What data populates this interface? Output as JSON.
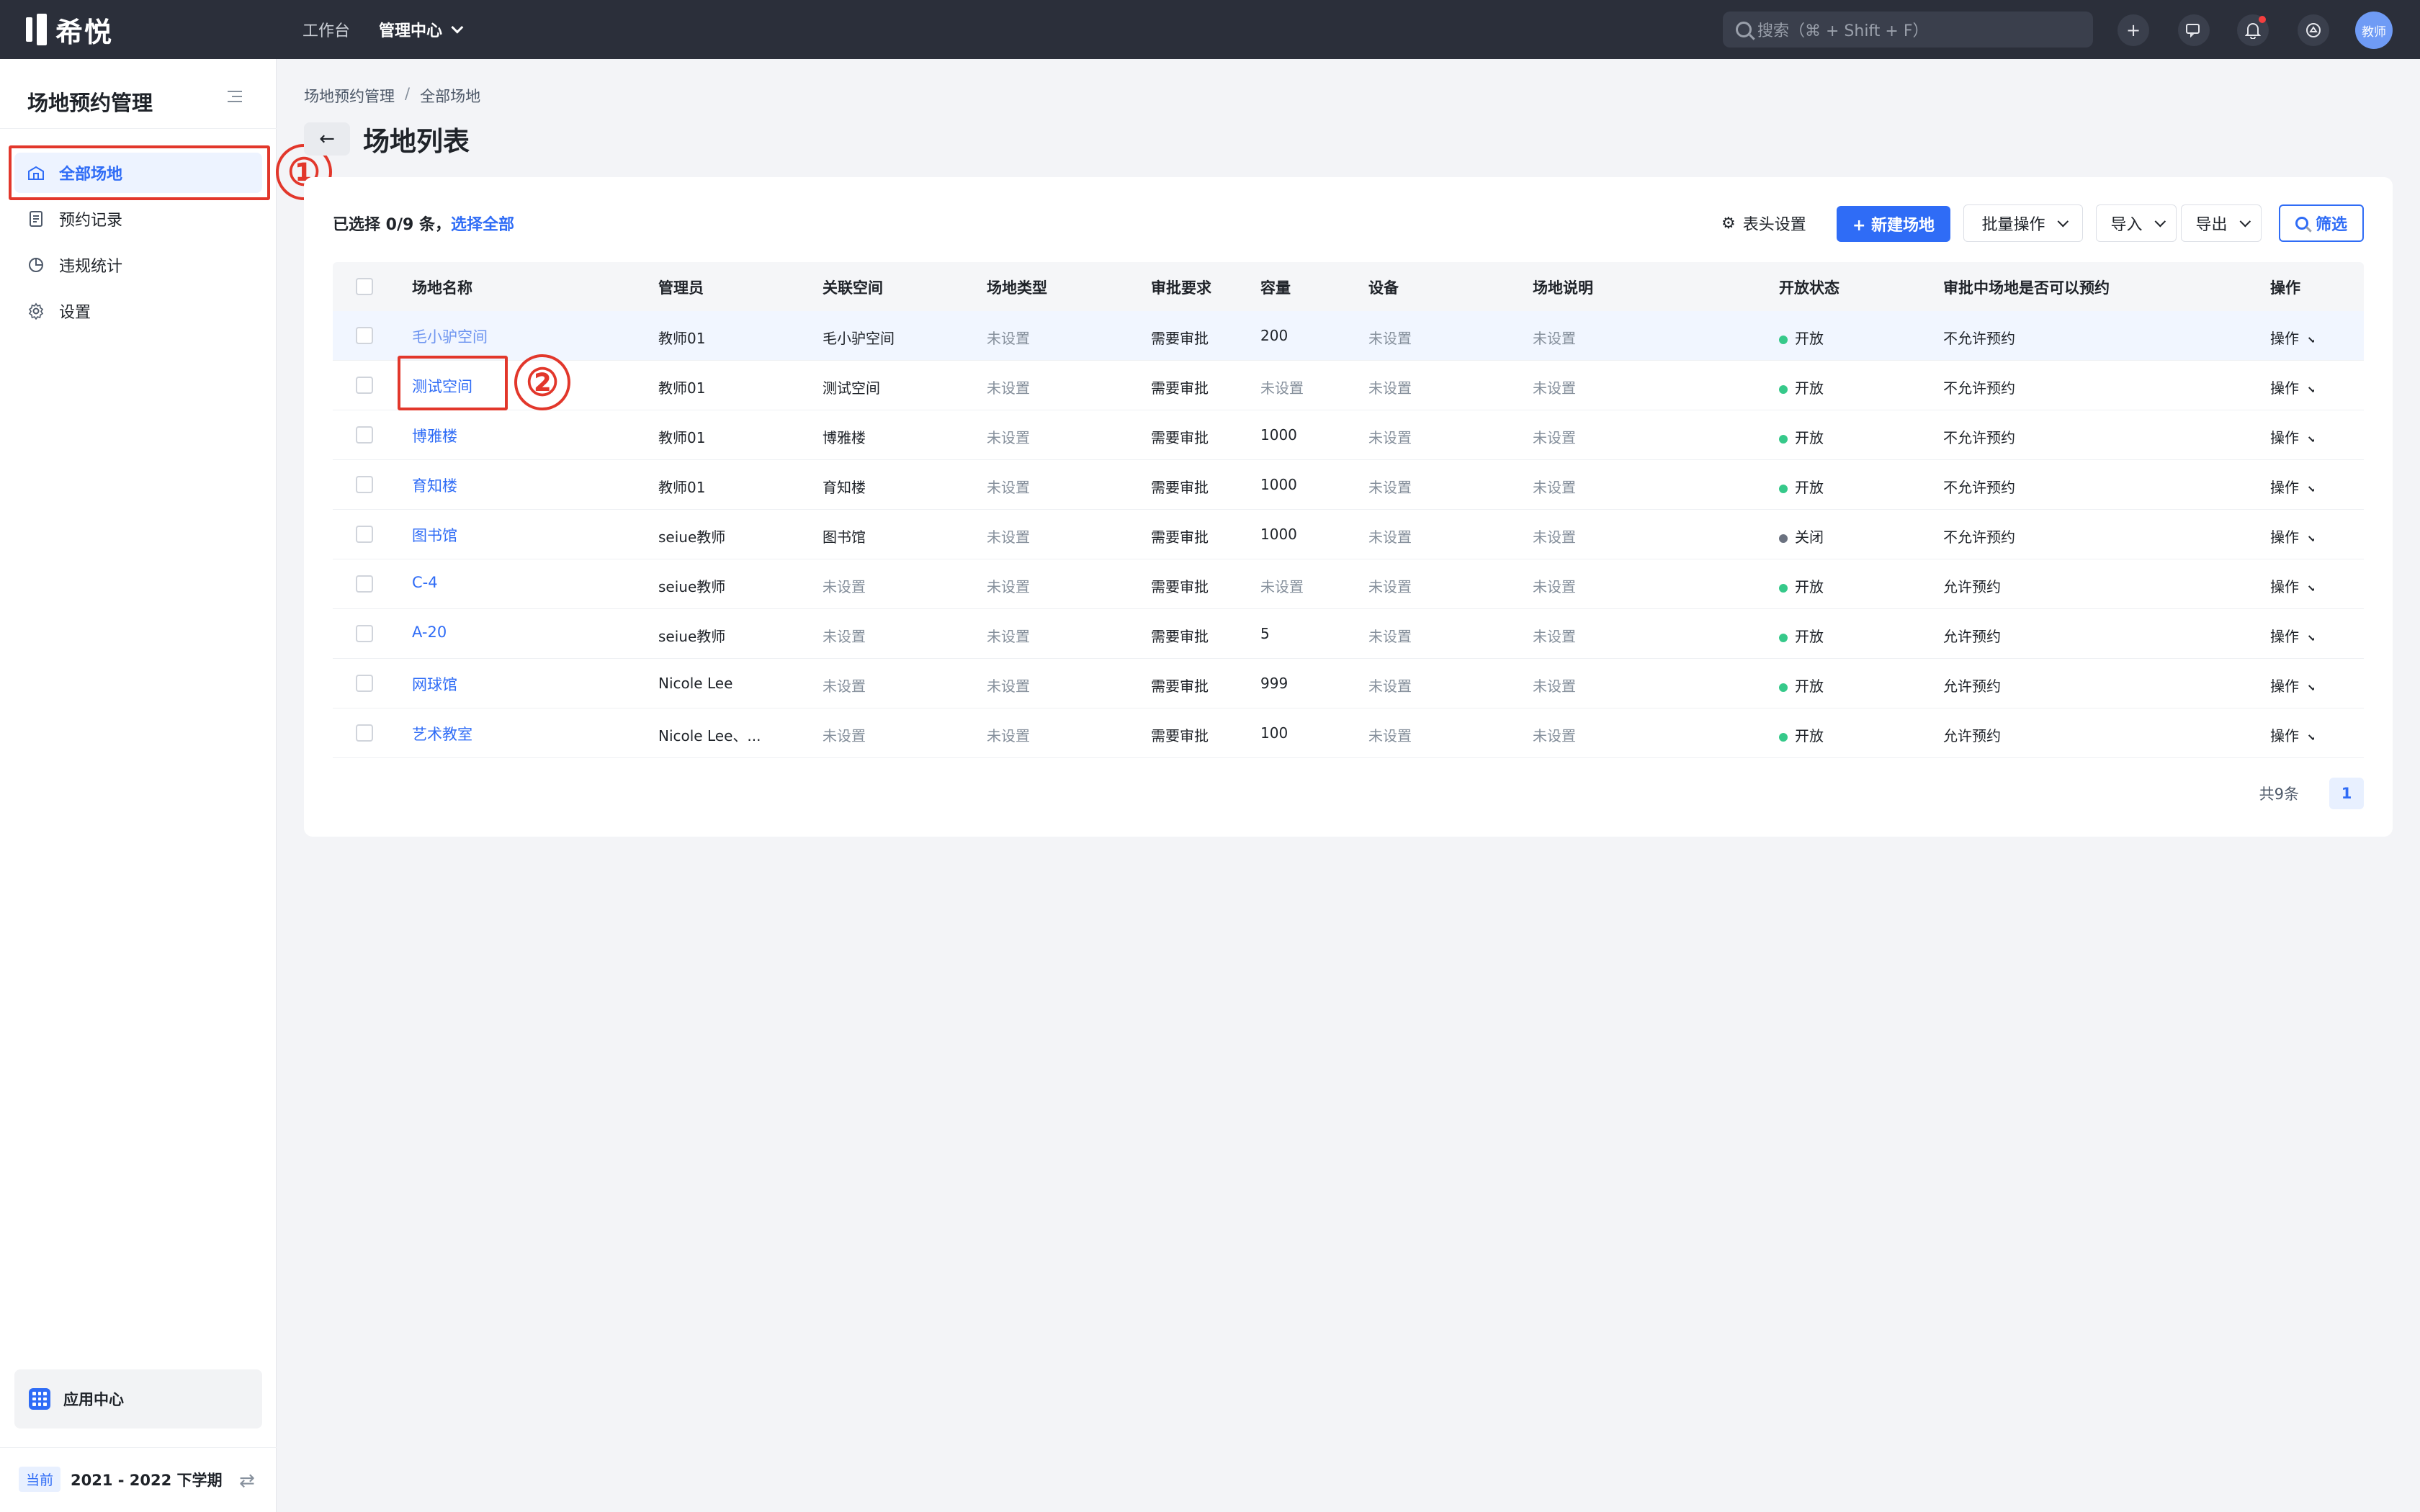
{
  "topbar": {
    "logo_text": "希悦",
    "nav": [
      "工作台",
      "管理中心"
    ],
    "search_placeholder": "搜索（⌘ + Shift + F）",
    "avatar_text": "教师"
  },
  "sidebar": {
    "title": "场地预约管理",
    "items": [
      {
        "label": "全部场地",
        "icon": "building-icon"
      },
      {
        "label": "预约记录",
        "icon": "document-icon"
      },
      {
        "label": "违规统计",
        "icon": "pie-chart-icon"
      },
      {
        "label": "设置",
        "icon": "gear-icon"
      }
    ],
    "app_center": "应用中心",
    "term_tag": "当前",
    "term": "2021 - 2022 下学期"
  },
  "annotations": {
    "one": "①",
    "two": "②"
  },
  "breadcrumb": [
    "场地预约管理",
    "全部场地"
  ],
  "page_title": "场地列表",
  "toolbar": {
    "selection_prefix": "已选择 0/9 条，",
    "select_all": "选择全部",
    "column_settings": "表头设置",
    "new_venue": "+ 新建场地",
    "batch": "批量操作",
    "import": "导入",
    "export": "导出",
    "filter": "筛选"
  },
  "table": {
    "headers": [
      "场地名称",
      "管理员",
      "关联空间",
      "场地类型",
      "审批要求",
      "容量",
      "设备",
      "场地说明",
      "开放状态",
      "审批中场地是否可以预约",
      "操作"
    ],
    "rows": [
      {
        "name": "毛小驴空间",
        "admin": "教师01",
        "space": "毛小驴空间",
        "type": "未设置",
        "approval": "需要审批",
        "capacity": "200",
        "device": "未设置",
        "desc": "未设置",
        "status": "开放",
        "booking": "不允许预约",
        "op": "操作"
      },
      {
        "name": "测试空间",
        "admin": "教师01",
        "space": "测试空间",
        "type": "未设置",
        "approval": "需要审批",
        "capacity": "未设置",
        "device": "未设置",
        "desc": "未设置",
        "status": "开放",
        "booking": "不允许预约",
        "op": "操作"
      },
      {
        "name": "博雅楼",
        "admin": "教师01",
        "space": "博雅楼",
        "type": "未设置",
        "approval": "需要审批",
        "capacity": "1000",
        "device": "未设置",
        "desc": "未设置",
        "status": "开放",
        "booking": "不允许预约",
        "op": "操作"
      },
      {
        "name": "育知楼",
        "admin": "教师01",
        "space": "育知楼",
        "type": "未设置",
        "approval": "需要审批",
        "capacity": "1000",
        "device": "未设置",
        "desc": "未设置",
        "status": "开放",
        "booking": "不允许预约",
        "op": "操作"
      },
      {
        "name": "图书馆",
        "admin": "seiue教师",
        "space": "图书馆",
        "type": "未设置",
        "approval": "需要审批",
        "capacity": "1000",
        "device": "未设置",
        "desc": "未设置",
        "status": "关闭",
        "booking": "不允许预约",
        "op": "操作"
      },
      {
        "name": "C-4",
        "admin": "seiue教师",
        "space": "未设置",
        "type": "未设置",
        "approval": "需要审批",
        "capacity": "未设置",
        "device": "未设置",
        "desc": "未设置",
        "status": "开放",
        "booking": "允许预约",
        "op": "操作"
      },
      {
        "name": "A-20",
        "admin": "seiue教师",
        "space": "未设置",
        "type": "未设置",
        "approval": "需要审批",
        "capacity": "5",
        "device": "未设置",
        "desc": "未设置",
        "status": "开放",
        "booking": "允许预约",
        "op": "操作"
      },
      {
        "name": "网球馆",
        "admin": "Nicole Lee",
        "space": "未设置",
        "type": "未设置",
        "approval": "需要审批",
        "capacity": "999",
        "device": "未设置",
        "desc": "未设置",
        "status": "开放",
        "booking": "允许预约",
        "op": "操作"
      },
      {
        "name": "艺术教室",
        "admin": "Nicole Lee、...",
        "space": "未设置",
        "type": "未设置",
        "approval": "需要审批",
        "capacity": "100",
        "device": "未设置",
        "desc": "未设置",
        "status": "开放",
        "booking": "允许预约",
        "op": "操作"
      }
    ]
  },
  "pager": {
    "total": "共9条",
    "current": "1"
  },
  "colors": {
    "accent": "#2f6cf6",
    "open": "#36c98a",
    "closed": "#6b7280",
    "annotation": "#e2372b"
  }
}
